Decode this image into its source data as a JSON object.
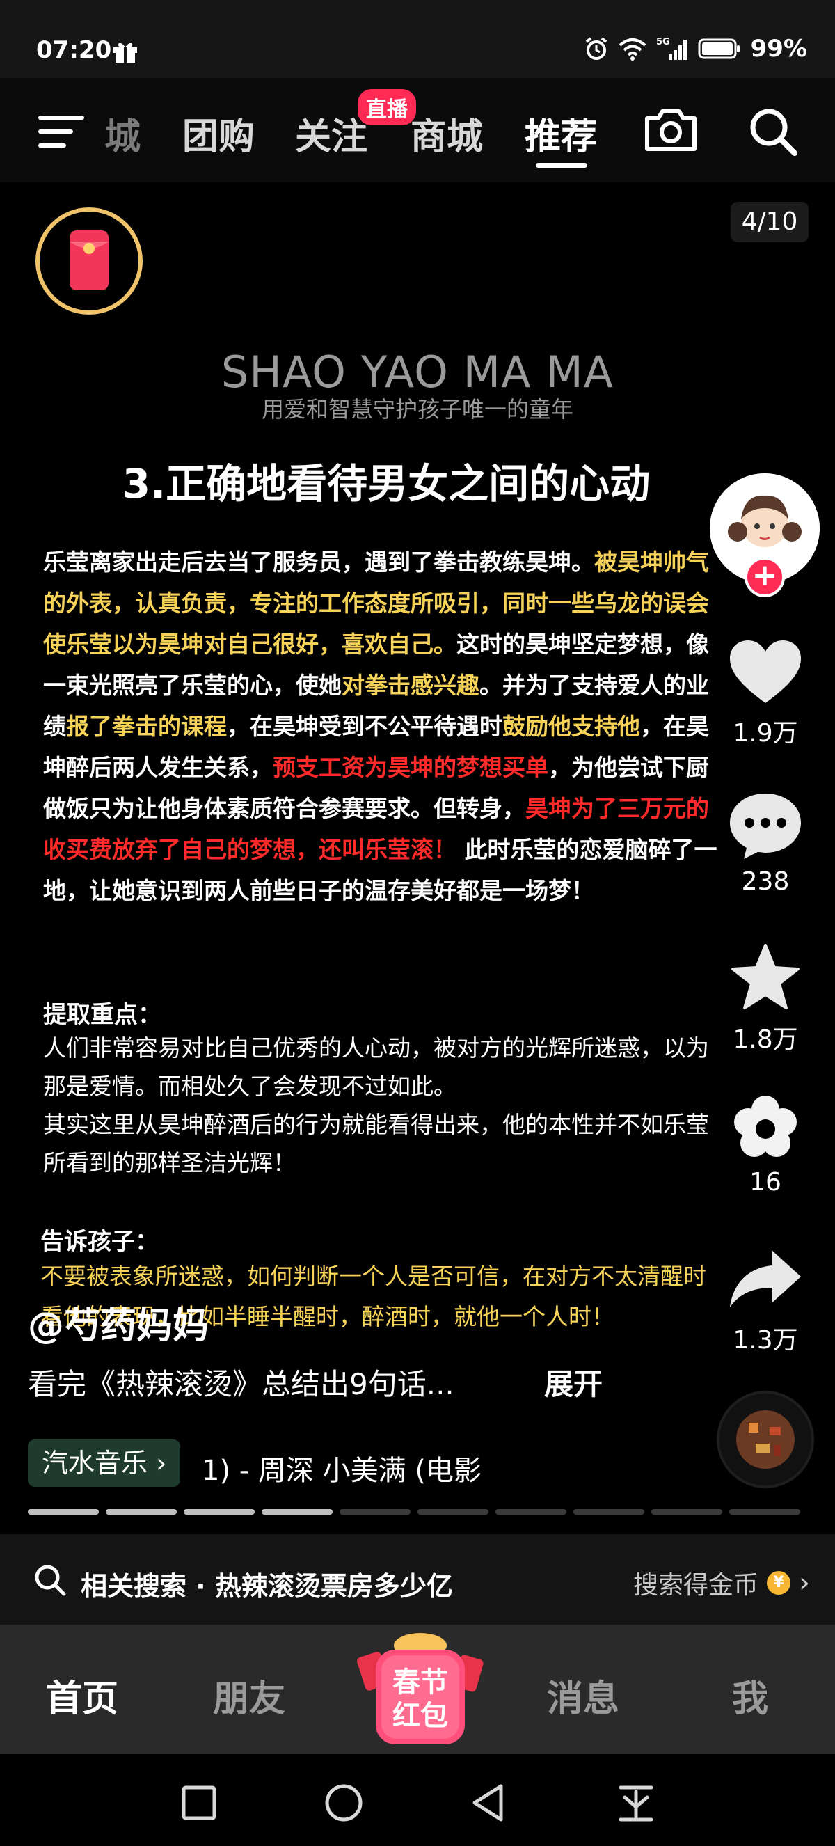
{
  "status_bar": {
    "time": "07:20",
    "battery": "99%",
    "signal_label": "5G"
  },
  "top_nav": {
    "tabs": [
      {
        "label": "城"
      },
      {
        "label": "团购"
      },
      {
        "label": "关注"
      },
      {
        "label": "商城"
      },
      {
        "label": "推荐",
        "active": true
      }
    ],
    "live_badge": "直播"
  },
  "page_counter": "4/10",
  "brand": {
    "title": "SHAO YAO MA MA",
    "subtitle": "用爱和智慧守护孩子唯一的童年"
  },
  "heading": "3.正确地看待男女之间的心动",
  "story": {
    "p1": "乐莹离家出走后去当了服务员，遇到了拳击教练昊坤。",
    "p2": "被昊坤帅气的外表，认真负责，专注的工作态度所吸引，同时一些乌龙的误会使乐莹以为昊坤对自己很好，喜欢自己。",
    "p3": "这时的昊坤坚定梦想，像一束光照亮了乐莹的心，使她",
    "p4": "对拳击感兴趣",
    "p5": "。并为了支持爱人的业绩",
    "p6": "报了拳击的课程",
    "p7": "，在昊坤受到不公平待遇时",
    "p8": "鼓励他支持他",
    "p9": "，在昊坤醉后两人发生关系，",
    "p10": "预支工资为昊坤的梦想买单",
    "p11": "，为他尝试下厨做饭只为让他身体素质符合参赛要求。但转身，",
    "p12": "昊坤为了三万元的收买费放弃了自己的梦想，还叫乐莹滚！",
    "p13": " 此时乐莹的恋爱脑碎了一地，让她意识到两人前些日子的温存美好都是一场梦！"
  },
  "key_points": {
    "title": "提取重点：",
    "line1": "人们非常容易对比自己优秀的人心动，被对方的光辉所迷惑，以为那是爱情。而相处久了会发现不过如此。",
    "line2": "其实这里从昊坤醉酒后的行为就能看得出来，他的本性并不如乐莹所看到的那样圣洁光辉！"
  },
  "tell_kids": {
    "title": "告诉孩子：",
    "text": "不要被表象所迷惑，如何判断一个人是否可信，在对方不太清醒时看他的表现，比如半睡半醒时，醉酒时，就他一个人时！"
  },
  "rail": {
    "likes": "1.9万",
    "comments": "238",
    "favorites": "1.8万",
    "flower": "16",
    "shares": "1.3万"
  },
  "author": "@芍药妈妈",
  "caption": "看完《热辣滚烫》总结出9句话...",
  "expand_label": "展开",
  "music": {
    "tag": "汽水音乐",
    "track": "1) - 周深    小美满 (电影"
  },
  "progress": {
    "total": 10,
    "current": 4
  },
  "related": {
    "label": "相关搜索 · 热辣滚烫票房多少亿",
    "right": "搜索得金币"
  },
  "tabbar": {
    "home": "首页",
    "friends": "朋友",
    "spring_top": "春节",
    "spring_bottom": "红包",
    "messages": "消息",
    "me": "我"
  },
  "colors": {
    "highlight_yellow": "#f6d358",
    "highlight_red": "#ff2a2a",
    "accent_pink": "#ff2b55"
  }
}
